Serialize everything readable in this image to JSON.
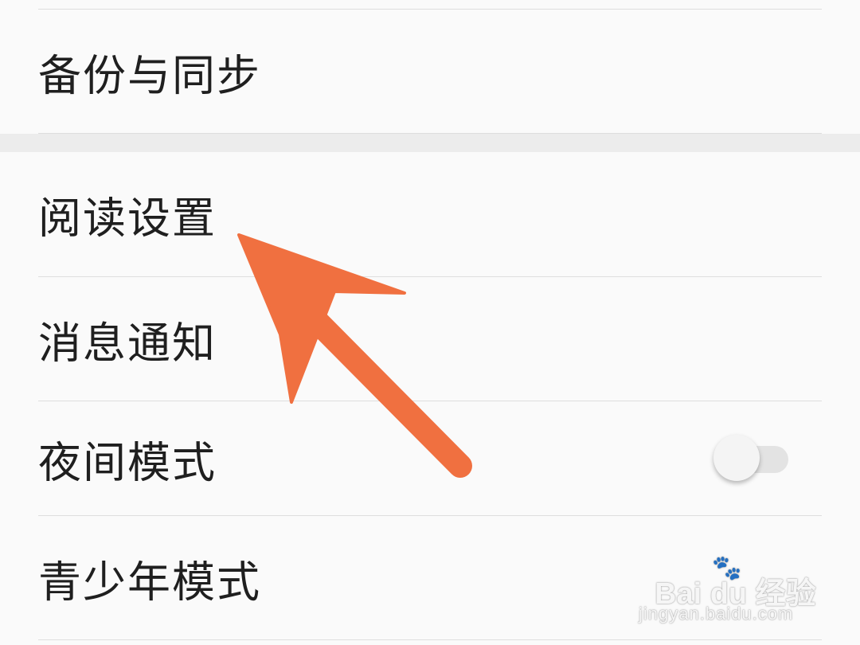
{
  "settings": {
    "items": [
      {
        "label": "备份与同步"
      },
      {
        "label": "阅读设置"
      },
      {
        "label": "消息通知"
      },
      {
        "label": "夜间模式",
        "toggle": "off"
      },
      {
        "label": "青少年模式"
      }
    ]
  },
  "annotation": {
    "arrow_color": "#f07040",
    "points_to": "阅读设置"
  },
  "watermark": {
    "logo": "Bai du 经验",
    "url": "jingyan.baidu.com"
  }
}
